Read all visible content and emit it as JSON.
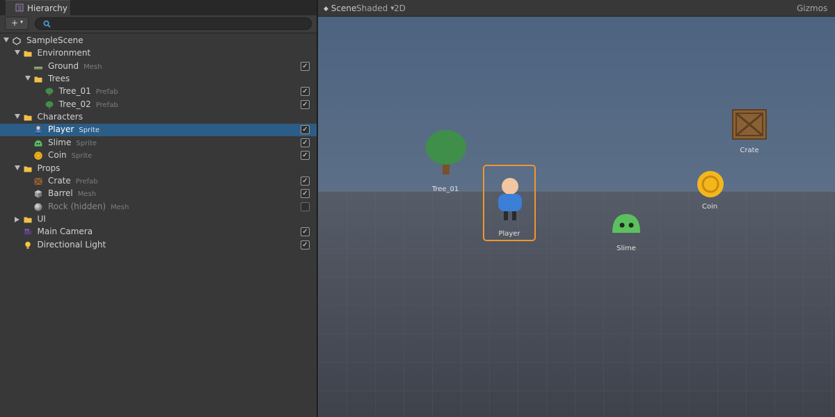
{
  "hierarchy": {
    "tab_label": "Hierarchy",
    "add_button": {
      "plus": "+",
      "caret": "▾"
    },
    "search": {
      "placeholder": "",
      "value": ""
    },
    "rows": [
      {
        "label": "SampleScene",
        "tag": "",
        "icon": "scene-icon",
        "expanded": true,
        "has_arrow": true,
        "depth": 0,
        "checkbox": null,
        "selected": false,
        "dim": false
      },
      {
        "label": "Environment",
        "tag": "",
        "icon": "folder-icon",
        "expanded": true,
        "has_arrow": true,
        "depth": 1,
        "checkbox": null,
        "selected": false,
        "dim": false
      },
      {
        "label": "Ground",
        "tag": "Mesh",
        "icon": "mesh-plane-icon",
        "expanded": false,
        "has_arrow": false,
        "depth": 2,
        "checkbox": true,
        "selected": false,
        "dim": false
      },
      {
        "label": "Trees",
        "tag": "",
        "icon": "folder-icon",
        "expanded": true,
        "has_arrow": true,
        "depth": 2,
        "checkbox": null,
        "selected": false,
        "dim": false
      },
      {
        "label": "Tree_01",
        "tag": "Prefab",
        "icon": "tree-icon",
        "expanded": false,
        "has_arrow": false,
        "depth": 3,
        "checkbox": true,
        "selected": false,
        "dim": false
      },
      {
        "label": "Tree_02",
        "tag": "Prefab",
        "icon": "tree-icon",
        "expanded": false,
        "has_arrow": false,
        "depth": 3,
        "checkbox": true,
        "selected": false,
        "dim": false
      },
      {
        "label": "Characters",
        "tag": "",
        "icon": "folder-icon",
        "expanded": true,
        "has_arrow": true,
        "depth": 1,
        "checkbox": null,
        "selected": false,
        "dim": false
      },
      {
        "label": "Player",
        "tag": "Sprite",
        "icon": "player-icon",
        "expanded": false,
        "has_arrow": false,
        "depth": 2,
        "checkbox": true,
        "selected": true,
        "dim": false
      },
      {
        "label": "Slime",
        "tag": "Sprite",
        "icon": "slime-icon",
        "expanded": false,
        "has_arrow": false,
        "depth": 2,
        "checkbox": true,
        "selected": false,
        "dim": false
      },
      {
        "label": "Coin",
        "tag": "Sprite",
        "icon": "coin-icon",
        "expanded": false,
        "has_arrow": false,
        "depth": 2,
        "checkbox": true,
        "selected": false,
        "dim": false
      },
      {
        "label": "Props",
        "tag": "",
        "icon": "folder-icon",
        "expanded": true,
        "has_arrow": true,
        "depth": 1,
        "checkbox": null,
        "selected": false,
        "dim": false
      },
      {
        "label": "Crate",
        "tag": "Prefab",
        "icon": "crate-icon",
        "expanded": false,
        "has_arrow": false,
        "depth": 2,
        "checkbox": true,
        "selected": false,
        "dim": false
      },
      {
        "label": "Barrel",
        "tag": "Mesh",
        "icon": "cube-icon",
        "expanded": false,
        "has_arrow": false,
        "depth": 2,
        "checkbox": true,
        "selected": false,
        "dim": false
      },
      {
        "label": "Rock (hidden)",
        "tag": "Mesh",
        "icon": "sphere-icon",
        "expanded": false,
        "has_arrow": false,
        "depth": 2,
        "checkbox": false,
        "selected": false,
        "dim": true
      },
      {
        "label": "UI",
        "tag": "",
        "icon": "folder-icon",
        "expanded": false,
        "has_arrow": true,
        "depth": 1,
        "checkbox": null,
        "selected": false,
        "dim": false
      },
      {
        "label": "Main Camera",
        "tag": "",
        "icon": "camera-icon",
        "expanded": false,
        "has_arrow": false,
        "depth": 1,
        "checkbox": true,
        "selected": false,
        "dim": false
      },
      {
        "label": "Directional Light",
        "tag": "",
        "icon": "light-icon",
        "expanded": false,
        "has_arrow": false,
        "depth": 1,
        "checkbox": true,
        "selected": false,
        "dim": false
      }
    ]
  },
  "scene": {
    "tab_icon": "scene-diamond-icon",
    "tab_label": "Scene",
    "shading_label": "Shaded",
    "mode_2d_label": "2D",
    "gizmos_label": "Gizmos",
    "objects": {
      "tree": "Tree_01",
      "player": "Player",
      "slime": "Slime",
      "coin": "Coin",
      "crate": "Crate"
    },
    "selected_object": "Player"
  },
  "colors": {
    "selection": "#2c5d87",
    "folder": "#f2c04a",
    "sky_top": "#4d6380",
    "ground": "#545a66",
    "selection_outline": "#f0962e",
    "tree_green": "#3f8f4a",
    "slime_green": "#5cc05e",
    "coin_gold": "#f3b71c",
    "crate_brown": "#8a6136",
    "player_blue": "#3b7fd6"
  }
}
